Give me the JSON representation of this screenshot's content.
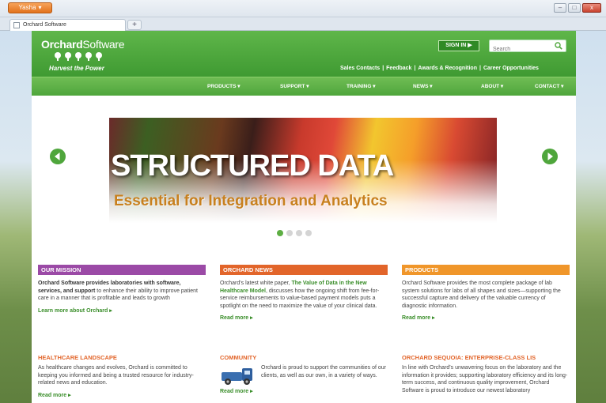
{
  "browser": {
    "app_button": "Yasha",
    "tab_title": "Orchard Software",
    "new_tab_label": "+",
    "controls": [
      "–",
      "□",
      "x"
    ]
  },
  "header": {
    "logo_bold": "Orchard",
    "logo_light": "Software",
    "tagline": "Harvest the Power",
    "signin_label": "SIGN IN ▶",
    "search_placeholder": "Search",
    "top_links": [
      "Sales Contacts",
      "Feedback",
      "Awards & Recognition",
      "Career Opportunities"
    ],
    "separator": "|"
  },
  "nav": {
    "items": [
      "PRODUCTS ▾",
      "SUPPORT ▾",
      "TRAINING ▾",
      "NEWS ▾",
      "ABOUT ▾",
      "CONTACT ▾"
    ]
  },
  "hero": {
    "title": "STRUCTURED DATA",
    "subtitle": "Essential for Integration and Analytics",
    "slide_count": 4,
    "active_slide": 1
  },
  "columns": {
    "mission": {
      "heading": "OUR MISSION",
      "color": "#9b4aa6",
      "bold_text": "Orchard Software provides laboratories with software, services, and support",
      "text": " to enhance their ability to improve patient care in a manner that is profitable and leads to growth",
      "link": "Learn more about Orchard ▸"
    },
    "news": {
      "heading": "ORCHARD NEWS",
      "color": "#e2652a",
      "text_before": "Orchard's latest white paper, ",
      "highlight": "The Value of Data in the New Healthcare Model",
      "text_after": ", discusses how the ongoing shift from fee-for-service reimbursements to value-based payment models puts a spotlight on the need to maximize the value of your clinical data.",
      "link": "Read more ▸"
    },
    "products": {
      "heading": "PRODUCTS",
      "color": "#f0962a",
      "text": "Orchard Software provides the most complete package of lab system solutions for labs of all shapes and sizes—supporting the successful capture and delivery of the valuable currency of diagnostic information.",
      "link": "Read more ▸"
    },
    "healthcare": {
      "heading": "HEALTHCARE LANDSCAPE",
      "color": "#e2652a",
      "text": "As healthcare changes and evolves, Orchard is committed to keeping you informed and being a trusted resource for industry-related news and education.",
      "link": "Read more ▸"
    },
    "community": {
      "heading": "COMMUNITY",
      "color": "#e2652a",
      "text": "Orchard is proud to support the communities of our clients, as well as our own, in a variety of ways.",
      "link": "Read more ▸"
    },
    "sequoia": {
      "heading": "ORCHARD SEQUOIA: ENTERPRISE-CLASS LIS",
      "color": "#e2652a",
      "text": "In line with Orchard's unwavering focus on the laboratory and the information it provides; supporting laboratory efficiency and its long-term success, and continuous quality improvement, Orchard Software is proud to introduce our newest laboratory"
    }
  },
  "colors": {
    "brand_green": "#4fa63c",
    "link_green": "#3a8e2a",
    "hero_subtitle": "#c8801e"
  }
}
